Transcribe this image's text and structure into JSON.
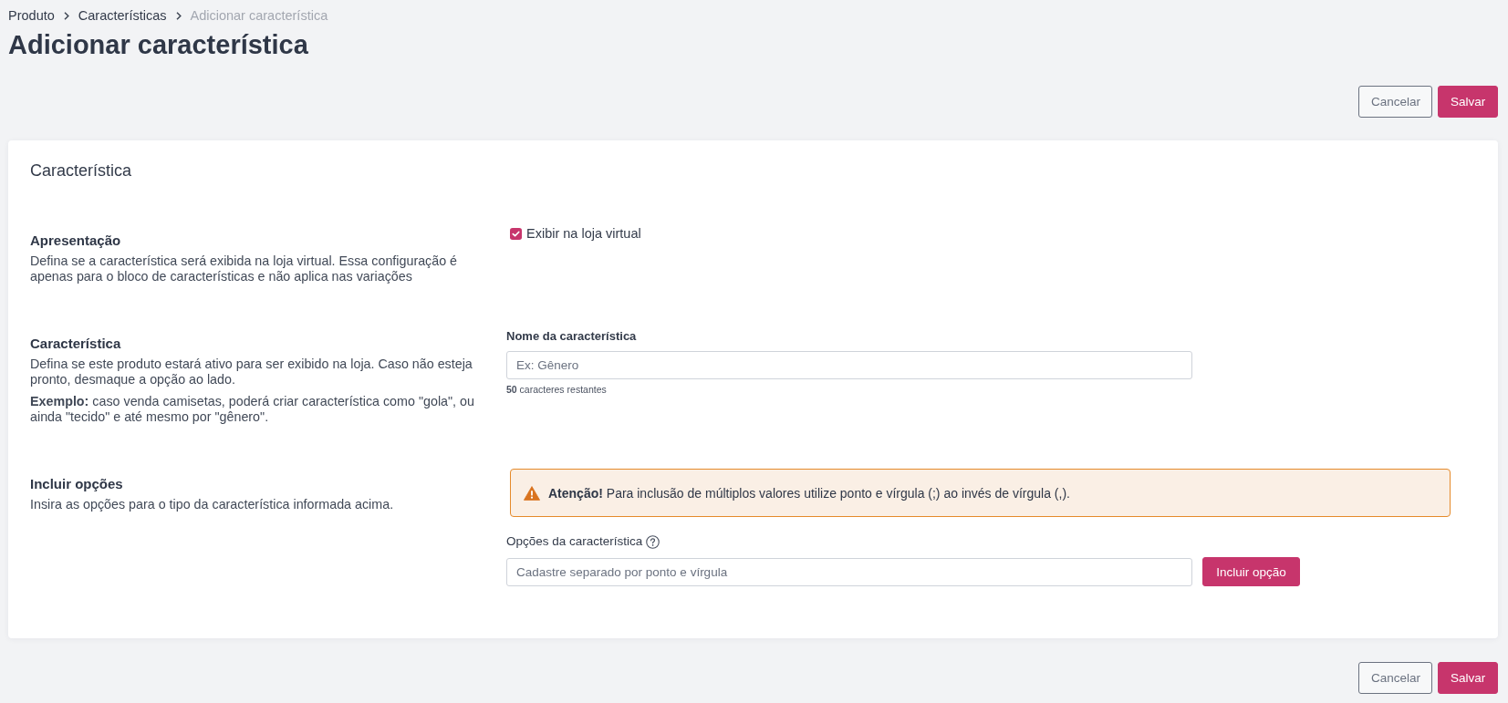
{
  "breadcrumb": [
    {
      "label": "Produto",
      "current": false
    },
    {
      "label": "Características",
      "current": false
    },
    {
      "label": "Adicionar característica",
      "current": true
    }
  ],
  "page_title": "Adicionar característica",
  "top_actions": [
    {
      "label": "Cancelar",
      "kind": "secondary"
    },
    {
      "label": "Salvar",
      "kind": "primary"
    }
  ],
  "card": {
    "title": "Característica",
    "sections": [
      {
        "kind": "checkbox",
        "heading": "Apresentação",
        "paragraphs": [
          "Defina se a característica será exibida na loja virtual. Essa configuração é apenas para o bloco de características e não aplica nas variações"
        ],
        "checkbox": {
          "label": "Exibir na loja virtual",
          "checked": true
        }
      },
      {
        "kind": "text_field",
        "heading": "Característica",
        "paragraphs": [
          "Defina se este produto estará ativo para ser exibido na loja. Caso não esteja pronto, desmaque a opção ao lado.",
          "**Exemplo:** caso venda camisetas, poderá criar característica como \"gola\", ou ainda \"tecido\" e até mesmo por \"gênero\"."
        ],
        "field": {
          "label": "Nome da característica",
          "placeholder": "Ex: Gênero",
          "hint": "**50** caracteres restantes"
        }
      },
      {
        "kind": "options",
        "heading": "Incluir opções",
        "paragraphs": [
          "Insira as opções para o tipo da característica informada acima."
        ],
        "alert": "**Atenção!** Para inclusão de múltiplos valores utilize ponto e vírgula (;) ao invés de vírgula (,).",
        "field": {
          "label": "Opções da característica",
          "placeholder": "Cadastre separado por ponto e vírgula"
        },
        "button": "Incluir opção"
      }
    ]
  },
  "bottom_actions": [
    {
      "label": "Cancelar",
      "kind": "secondary"
    },
    {
      "label": "Salvar",
      "kind": "primary"
    }
  ]
}
